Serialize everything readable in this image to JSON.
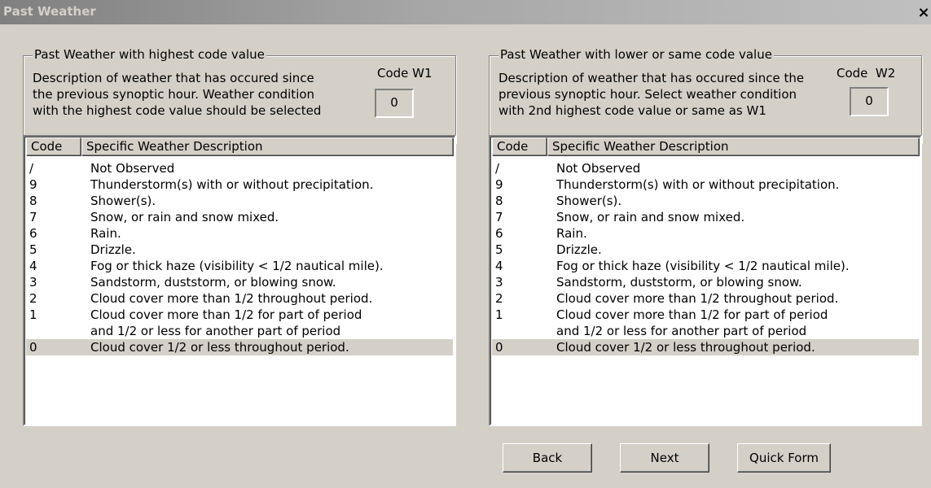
{
  "window": {
    "title": "Past Weather",
    "close_label": "×"
  },
  "w1": {
    "legend": "Past Weather with highest code value",
    "description": [
      "Description of weather that has occured since",
      "the previous synoptic hour.  Weather condition",
      "with the highest code value should be selected"
    ],
    "code_label": "Code W1",
    "code_value": "0"
  },
  "w2": {
    "legend": "Past Weather with lower or same code value",
    "description": [
      "Description of weather that has occured since the",
      "previous synoptic hour.  Select weather condition",
      "with 2nd highest code value or same as W1"
    ],
    "code_label": "Code  W2",
    "code_value": "0"
  },
  "table": {
    "headers": [
      "Code",
      "Specific Weather Description"
    ],
    "rows": [
      {
        "code": "/",
        "description": "Not Observed"
      },
      {
        "code": "9",
        "description": "Thunderstorm(s) with or without precipitation."
      },
      {
        "code": "8",
        "description": "Shower(s)."
      },
      {
        "code": "7",
        "description": "Snow, or rain and snow mixed."
      },
      {
        "code": "6",
        "description": "Rain."
      },
      {
        "code": "5",
        "description": "Drizzle."
      },
      {
        "code": "4",
        "description": "Fog or thick haze (visibility < 1/2 nautical mile)."
      },
      {
        "code": "3",
        "description": "Sandstorm, duststorm, or blowing snow."
      },
      {
        "code": "2",
        "description": "Cloud cover more than 1/2 throughout period."
      },
      {
        "code": "1",
        "description": "Cloud cover more than 1/2 for part of period and 1/2 or less for another part of period",
        "line1": "Cloud cover more than 1/2 for part of period",
        "line2": "and 1/2 or less for another part of period"
      },
      {
        "code": "0",
        "description": "Cloud cover 1/2 or less throughout period.",
        "selected": true
      }
    ]
  },
  "buttons": {
    "back": "Back",
    "next": "Next",
    "quick_form": "Quick Form"
  },
  "colors": {
    "face": "#d4d0c8",
    "selection": "#d4d0c8",
    "title_gradient_start": "#808080"
  }
}
